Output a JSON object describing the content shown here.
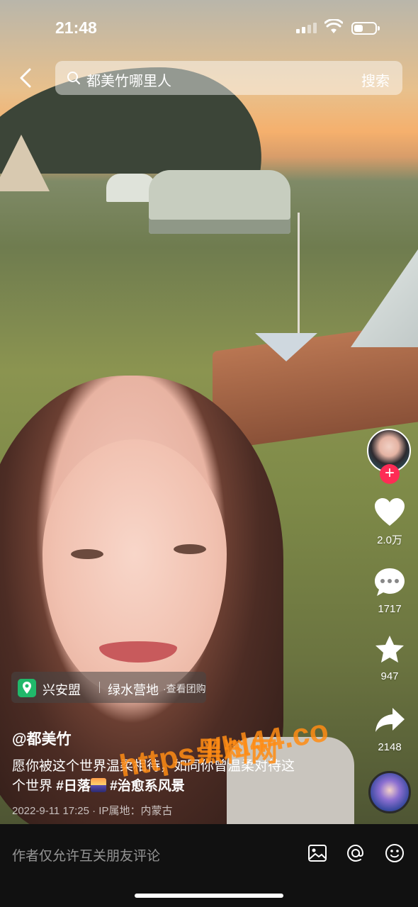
{
  "status_bar": {
    "time": "21:48"
  },
  "search": {
    "query": "都美竹哪里人",
    "button_label": "搜索"
  },
  "actions": {
    "like_count": "2.0万",
    "comment_count": "1717",
    "favorite_count": "947",
    "share_count": "2148"
  },
  "location": {
    "city": "兴安盟",
    "place": "绿水营地",
    "link": "·查看团购"
  },
  "post": {
    "author": "@都美竹",
    "caption_line1": "愿你被这个世界温柔相待，如同你曾温柔对待这",
    "caption_line2_prefix": "个世界",
    "tag1": "#日落",
    "tag2": "#治愈系风景",
    "meta": "2022-9-11 17:25 · IP属地：内蒙古"
  },
  "watermark": {
    "line1": "黑料网",
    "line2": "https://hl44.co"
  },
  "bottom_bar": {
    "comment_placeholder": "作者仅允许互关朋友评论"
  },
  "colors": {
    "accent": "#fe2c55",
    "location_pin": "#20b86a",
    "watermark": "#ff8c14"
  },
  "icons": [
    "back-icon",
    "search-icon",
    "heart-icon",
    "comment-icon",
    "star-icon",
    "share-icon",
    "image-icon",
    "at-icon",
    "emoji-icon"
  ]
}
